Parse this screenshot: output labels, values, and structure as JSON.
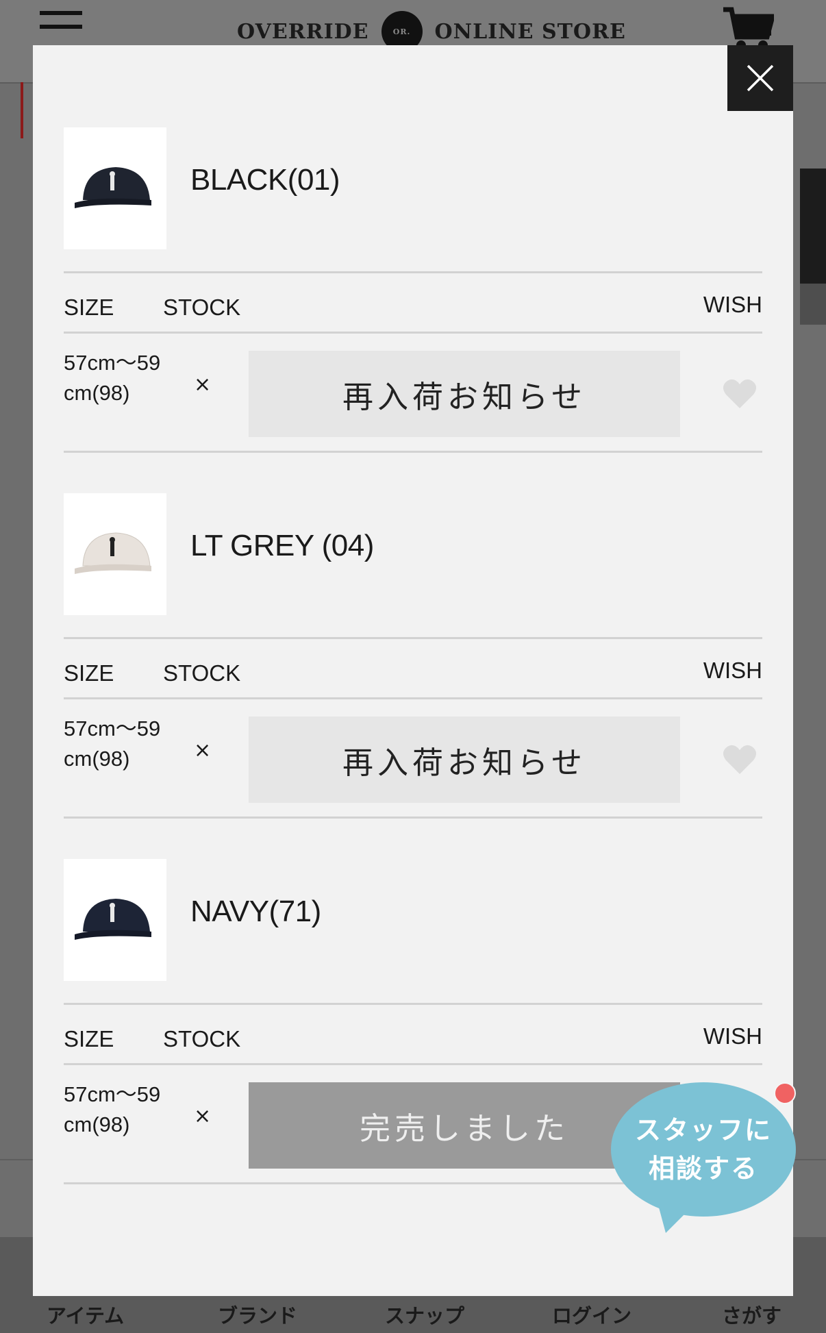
{
  "header": {
    "logo_left": "OVERRIDE",
    "logo_mark": "OR.",
    "logo_right": "ONLINE STORE"
  },
  "modal": {
    "variants": [
      {
        "color_name": "BLACK(01)",
        "thumb_color": "#1f2430",
        "col_size": "SIZE",
        "col_stock": "STOCK",
        "col_wish": "WISH",
        "size": "57cm〜59cm(98)",
        "stock": "×",
        "action_label": "再入荷お知らせ"
      },
      {
        "color_name": "LT GREY (04)",
        "thumb_color": "#e8e2dc",
        "col_size": "SIZE",
        "col_stock": "STOCK",
        "col_wish": "WISH",
        "size": "57cm〜59cm(98)",
        "stock": "×",
        "action_label": "再入荷お知らせ"
      },
      {
        "color_name": "NAVY(71)",
        "thumb_color": "#1d2436",
        "col_size": "SIZE",
        "col_stock": "STOCK",
        "col_wish": "WISH",
        "size": "57cm〜59cm(98)",
        "stock": "×",
        "action_label": "完売しました"
      }
    ]
  },
  "staff_chat": {
    "line1": "スタッフに",
    "line2": "相談する"
  },
  "bottom_nav": {
    "items": [
      "アイテム",
      "ブランド",
      "スナップ",
      "ログイン",
      "さがす"
    ]
  },
  "colors": {
    "overlay": "#6e6e6e",
    "modal_bg": "#f2f2f2",
    "restock_btn": "#e6e6e6",
    "soldout_btn": "#9a9a9a",
    "chat_bubble": "#7cc2d5",
    "notif_dot": "#f06262"
  }
}
